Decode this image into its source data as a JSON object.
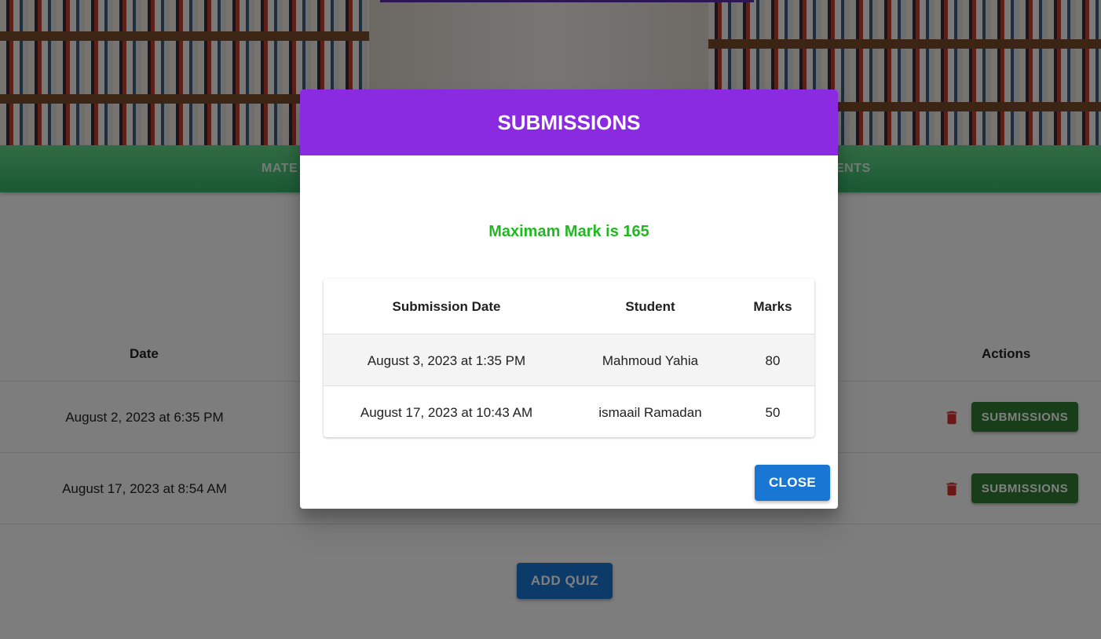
{
  "background": {
    "tabs": [
      "MATE",
      "ENTS"
    ],
    "quiz_table": {
      "headers": {
        "date": "Date",
        "actions": "Actions"
      },
      "rows": [
        {
          "date": "August 2, 2023 at 6:35 PM",
          "submissions_label": "SUBMISSIONS"
        },
        {
          "date": "August 17, 2023 at 8:54 AM",
          "submissions_label": "SUBMISSIONS"
        }
      ]
    },
    "add_quiz_label": "ADD QUIZ"
  },
  "modal": {
    "title": "SUBMISSIONS",
    "max_mark": "Maximam Mark is 165",
    "table": {
      "headers": [
        "Submission Date",
        "Student",
        "Marks"
      ],
      "rows": [
        [
          "August 3, 2023 at 1:35 PM",
          "Mahmoud Yahia",
          "80"
        ],
        [
          "August 17, 2023 at 10:43 AM",
          "ismaail Ramadan",
          "50"
        ]
      ]
    },
    "close_label": "CLOSE"
  },
  "colors": {
    "modal_header": "#8a2be2",
    "max_mark_text": "#22b822",
    "primary_button": "#1976d2",
    "submissions_button": "#2e7d32",
    "delete_icon": "#d32f2f",
    "tabs_bar": "#4cc77a"
  },
  "icons": [
    "trash-icon"
  ]
}
